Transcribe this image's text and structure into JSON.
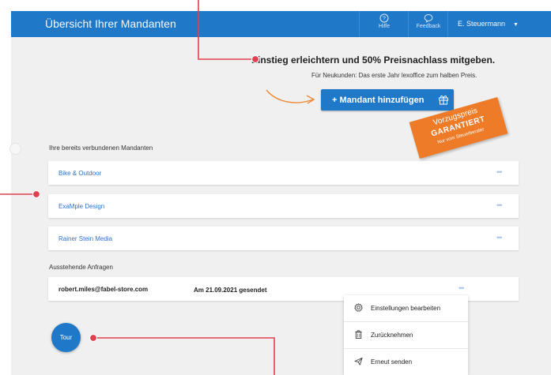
{
  "topbar": {
    "title": "Übersicht Ihrer Mandanten",
    "help_label": "Hilfe",
    "feedback_label": "Feedback",
    "user_name": "E. Steuermann",
    "bg_color": "#1f78c8"
  },
  "promo": {
    "headline": "Einstieg erleichtern und 50% Preisnachlass mitgeben.",
    "subline": "Für Neukunden: Das erste Jahr lexoffice zum halben Preis.",
    "add_button_label": "+ Mandant hinzufügen"
  },
  "badge": {
    "line1": "Vorzugspreis",
    "line2": "GARANTIERT",
    "line3": "Nur vom Steuerberater",
    "color": "#ed7b27"
  },
  "clients": {
    "heading": "Ihre bereits verbundenen Mandanten",
    "items": [
      {
        "name": "Bike & Outdoor"
      },
      {
        "name": "ExaMple Design"
      },
      {
        "name": "Rainer Stein Media"
      }
    ],
    "more_icon": "more-dots-icon"
  },
  "pending": {
    "heading": "Ausstehende Anfragen",
    "email": "robert.miles@fabel-store.com",
    "sent": "Am 21.09.2021 gesendet"
  },
  "context_menu": {
    "items": [
      {
        "label": "Einstellungen bearbeiten",
        "icon": "gear-icon"
      },
      {
        "label": "Zurücknehmen",
        "icon": "trash-icon"
      },
      {
        "label": "Erneut senden",
        "icon": "send-icon"
      }
    ]
  },
  "tour_button_label": "Tour",
  "annotation_color": "#e0404f"
}
